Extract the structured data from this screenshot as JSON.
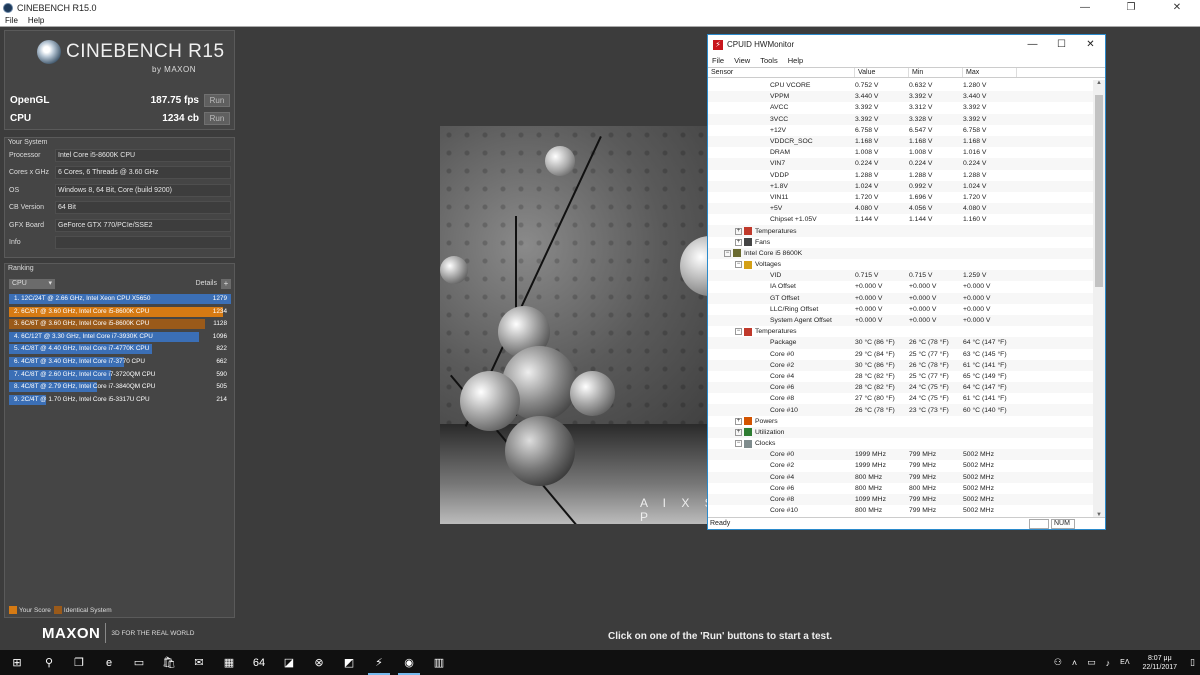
{
  "cinebench": {
    "title": "CINEBENCH R15.0",
    "menu": [
      "File",
      "Help"
    ],
    "window_buttons": [
      "—",
      "❐",
      "✕"
    ],
    "logo_text": "CINEBENCH R15",
    "logo_sub": "by MAXON",
    "scores": [
      {
        "label": "OpenGL",
        "value": "187.75 fps",
        "button": "Run"
      },
      {
        "label": "CPU",
        "value": "1234 cb",
        "button": "Run"
      }
    ],
    "system": {
      "title": "Your System",
      "rows": [
        {
          "key": "Processor",
          "value": "Intel Core i5-8600K CPU"
        },
        {
          "key": "Cores x GHz",
          "value": "6 Cores, 6 Threads @ 3.60 GHz"
        },
        {
          "key": "OS",
          "value": "Windows 8, 64 Bit, Core (build 9200)"
        },
        {
          "key": "CB Version",
          "value": "64 Bit"
        },
        {
          "key": "GFX Board",
          "value": "GeForce GTX 770/PCIe/SSE2"
        },
        {
          "key": "Info",
          "value": ""
        }
      ]
    },
    "ranking": {
      "title": "Ranking",
      "select_value": "CPU",
      "details_label": "Details",
      "details_btn": "+",
      "items": [
        {
          "label": "1. 12C/24T @ 2.66 GHz, Intel Xeon CPU X5650",
          "score": "1279",
          "fraction": 1.0,
          "color": "#3b6fb6"
        },
        {
          "label": "2. 6C/6T @ 3.60 GHz, Intel Core i5-8600K CPU",
          "score": "1234",
          "fraction": 0.965,
          "color": "#d67a13"
        },
        {
          "label": "3. 6C/6T @ 3.60 GHz, Intel Core i5-8600K CPU",
          "score": "1128",
          "fraction": 0.882,
          "color": "#9a5a1a"
        },
        {
          "label": "4. 6C/12T @ 3.30 GHz,  Intel Core i7-3930K CPU",
          "score": "1096",
          "fraction": 0.857,
          "color": "#3b6fb6"
        },
        {
          "label": "5. 4C/8T @ 4.40 GHz, Intel Core i7-4770K CPU",
          "score": "822",
          "fraction": 0.643,
          "color": "#3b6fb6"
        },
        {
          "label": "6. 4C/8T @ 3.40 GHz,  Intel Core i7-3770 CPU",
          "score": "662",
          "fraction": 0.518,
          "color": "#3b6fb6"
        },
        {
          "label": "7. 4C/8T @ 2.60 GHz, Intel Core i7-3720QM CPU",
          "score": "590",
          "fraction": 0.461,
          "color": "#3b6fb6"
        },
        {
          "label": "8. 4C/8T @ 2.79 GHz,  Intel Core i7-3840QM CPU",
          "score": "505",
          "fraction": 0.395,
          "color": "#3b6fb6"
        },
        {
          "label": "9. 2C/4T @ 1.70 GHz,  Intel Core i5-3317U CPU",
          "score": "214",
          "fraction": 0.167,
          "color": "#3b6fb6"
        }
      ],
      "legend": [
        {
          "label": "Your Score",
          "color": "#d67a13"
        },
        {
          "label": "Identical System",
          "color": "#9a5a1a"
        }
      ]
    },
    "maxon_logo": "MAXON",
    "maxon_tag": "3D FOR THE REAL WORLD",
    "status_message": "Click on one of the 'Run' buttons to start a test.",
    "render_watermark": "A I X S P"
  },
  "hwmonitor": {
    "title": "CPUID HWMonitor",
    "icon_glyph": "⚡",
    "window_buttons": [
      "—",
      "☐",
      "✕"
    ],
    "menu": [
      "File",
      "View",
      "Tools",
      "Help"
    ],
    "columns": [
      "Sensor",
      "Value",
      "Min",
      "Max"
    ],
    "rows": [
      {
        "level": 3,
        "name": "CPU VCORE",
        "value": "0.752 V",
        "min": "0.632 V",
        "max": "1.280 V"
      },
      {
        "level": 3,
        "name": "VPPM",
        "value": "3.440 V",
        "min": "3.392 V",
        "max": "3.440 V"
      },
      {
        "level": 3,
        "name": "AVCC",
        "value": "3.392 V",
        "min": "3.312 V",
        "max": "3.392 V"
      },
      {
        "level": 3,
        "name": "3VCC",
        "value": "3.392 V",
        "min": "3.328 V",
        "max": "3.392 V"
      },
      {
        "level": 3,
        "name": "+12V",
        "value": "6.758 V",
        "min": "6.547 V",
        "max": "6.758 V"
      },
      {
        "level": 3,
        "name": "VDDCR_SOC",
        "value": "1.168 V",
        "min": "1.168 V",
        "max": "1.168 V"
      },
      {
        "level": 3,
        "name": "DRAM",
        "value": "1.008 V",
        "min": "1.008 V",
        "max": "1.016 V"
      },
      {
        "level": 3,
        "name": "VIN7",
        "value": "0.224 V",
        "min": "0.224 V",
        "max": "0.224 V"
      },
      {
        "level": 3,
        "name": "VDDP",
        "value": "1.288 V",
        "min": "1.288 V",
        "max": "1.288 V"
      },
      {
        "level": 3,
        "name": "+1.8V",
        "value": "1.024 V",
        "min": "0.992 V",
        "max": "1.024 V"
      },
      {
        "level": 3,
        "name": "VIN11",
        "value": "1.720 V",
        "min": "1.696 V",
        "max": "1.720 V"
      },
      {
        "level": 3,
        "name": "+5V",
        "value": "4.080 V",
        "min": "4.056 V",
        "max": "4.080 V"
      },
      {
        "level": 3,
        "name": "Chipset +1.05V",
        "value": "1.144 V",
        "min": "1.144 V",
        "max": "1.160 V"
      },
      {
        "level": 2,
        "name": "Temperatures",
        "expander": "+",
        "icon": "#c0392b",
        "value": "",
        "min": "",
        "max": ""
      },
      {
        "level": 2,
        "name": "Fans",
        "expander": "+",
        "icon": "#444444",
        "value": "",
        "min": "",
        "max": ""
      },
      {
        "level": 1,
        "name": "Intel Core i5 8600K",
        "expander": "−",
        "icon": "#6a6a30",
        "value": "",
        "min": "",
        "max": ""
      },
      {
        "level": 2,
        "name": "Voltages",
        "expander": "−",
        "icon": "#d4a017",
        "value": "",
        "min": "",
        "max": ""
      },
      {
        "level": 3,
        "name": "VID",
        "value": "0.715 V",
        "min": "0.715 V",
        "max": "1.259 V"
      },
      {
        "level": 3,
        "name": "IA Offset",
        "value": "+0.000 V",
        "min": "+0.000 V",
        "max": "+0.000 V"
      },
      {
        "level": 3,
        "name": "GT Offset",
        "value": "+0.000 V",
        "min": "+0.000 V",
        "max": "+0.000 V"
      },
      {
        "level": 3,
        "name": "LLC/Ring Offset",
        "value": "+0.000 V",
        "min": "+0.000 V",
        "max": "+0.000 V"
      },
      {
        "level": 3,
        "name": "System Agent Offset",
        "value": "+0.000 V",
        "min": "+0.000 V",
        "max": "+0.000 V"
      },
      {
        "level": 2,
        "name": "Temperatures",
        "expander": "−",
        "icon": "#c0392b",
        "value": "",
        "min": "",
        "max": ""
      },
      {
        "level": 3,
        "name": "Package",
        "value": "30 °C  (86 °F)",
        "min": "26 °C  (78 °F)",
        "max": "64 °C  (147 °F)"
      },
      {
        "level": 3,
        "name": "Core #0",
        "value": "29 °C  (84 °F)",
        "min": "25 °C  (77 °F)",
        "max": "63 °C  (145 °F)"
      },
      {
        "level": 3,
        "name": "Core #2",
        "value": "30 °C  (86 °F)",
        "min": "26 °C  (78 °F)",
        "max": "61 °C  (141 °F)"
      },
      {
        "level": 3,
        "name": "Core #4",
        "value": "28 °C  (82 °F)",
        "min": "25 °C  (77 °F)",
        "max": "65 °C  (149 °F)"
      },
      {
        "level": 3,
        "name": "Core #6",
        "value": "28 °C  (82 °F)",
        "min": "24 °C  (75 °F)",
        "max": "64 °C  (147 °F)"
      },
      {
        "level": 3,
        "name": "Core #8",
        "value": "27 °C  (80 °F)",
        "min": "24 °C  (75 °F)",
        "max": "61 °C  (141 °F)"
      },
      {
        "level": 3,
        "name": "Core #10",
        "value": "26 °C  (78 °F)",
        "min": "23 °C  (73 °F)",
        "max": "60 °C  (140 °F)"
      },
      {
        "level": 2,
        "name": "Powers",
        "expander": "+",
        "icon": "#d35400",
        "value": "",
        "min": "",
        "max": ""
      },
      {
        "level": 2,
        "name": "Utilization",
        "expander": "+",
        "icon": "#2e7d32",
        "value": "",
        "min": "",
        "max": ""
      },
      {
        "level": 2,
        "name": "Clocks",
        "expander": "−",
        "icon": "#7f8c8d",
        "value": "",
        "min": "",
        "max": ""
      },
      {
        "level": 3,
        "name": "Core #0",
        "value": "1999 MHz",
        "min": "799 MHz",
        "max": "5002 MHz"
      },
      {
        "level": 3,
        "name": "Core #2",
        "value": "1999 MHz",
        "min": "799 MHz",
        "max": "5002 MHz"
      },
      {
        "level": 3,
        "name": "Core #4",
        "value": "800 MHz",
        "min": "799 MHz",
        "max": "5002 MHz"
      },
      {
        "level": 3,
        "name": "Core #6",
        "value": "800 MHz",
        "min": "800 MHz",
        "max": "5002 MHz"
      },
      {
        "level": 3,
        "name": "Core #8",
        "value": "1099 MHz",
        "min": "799 MHz",
        "max": "5002 MHz"
      },
      {
        "level": 3,
        "name": "Core #10",
        "value": "800 MHz",
        "min": "799 MHz",
        "max": "5002 MHz"
      }
    ],
    "status": "Ready",
    "num_indicator": "NUM"
  },
  "taskbar": {
    "items": [
      {
        "name": "start-button",
        "glyph": "⊞",
        "active": false
      },
      {
        "name": "search-icon",
        "glyph": "⚲",
        "active": false
      },
      {
        "name": "task-view-icon",
        "glyph": "❐",
        "active": false
      },
      {
        "name": "edge-icon",
        "glyph": "e",
        "active": false
      },
      {
        "name": "file-explorer-icon",
        "glyph": "▭",
        "active": false
      },
      {
        "name": "store-icon",
        "glyph": "🛍",
        "active": false
      },
      {
        "name": "mail-icon",
        "glyph": "✉",
        "active": false
      },
      {
        "name": "calculator-icon",
        "glyph": "▦",
        "active": false
      },
      {
        "name": "app-64-icon",
        "glyph": "64",
        "active": false
      },
      {
        "name": "app-gpu-icon",
        "glyph": "◪",
        "active": false
      },
      {
        "name": "xbox-icon",
        "glyph": "⊗",
        "active": false
      },
      {
        "name": "amd-icon",
        "glyph": "◩",
        "active": false
      },
      {
        "name": "hwmonitor-taskbar-icon",
        "glyph": "⚡",
        "active": true
      },
      {
        "name": "cinebench-taskbar-icon",
        "glyph": "◉",
        "active": true
      },
      {
        "name": "app-calendar-icon",
        "glyph": "▥",
        "active": false
      }
    ],
    "tray_language": "ΕΛ",
    "time": "8:07 μμ",
    "date": "22/11/2017"
  }
}
